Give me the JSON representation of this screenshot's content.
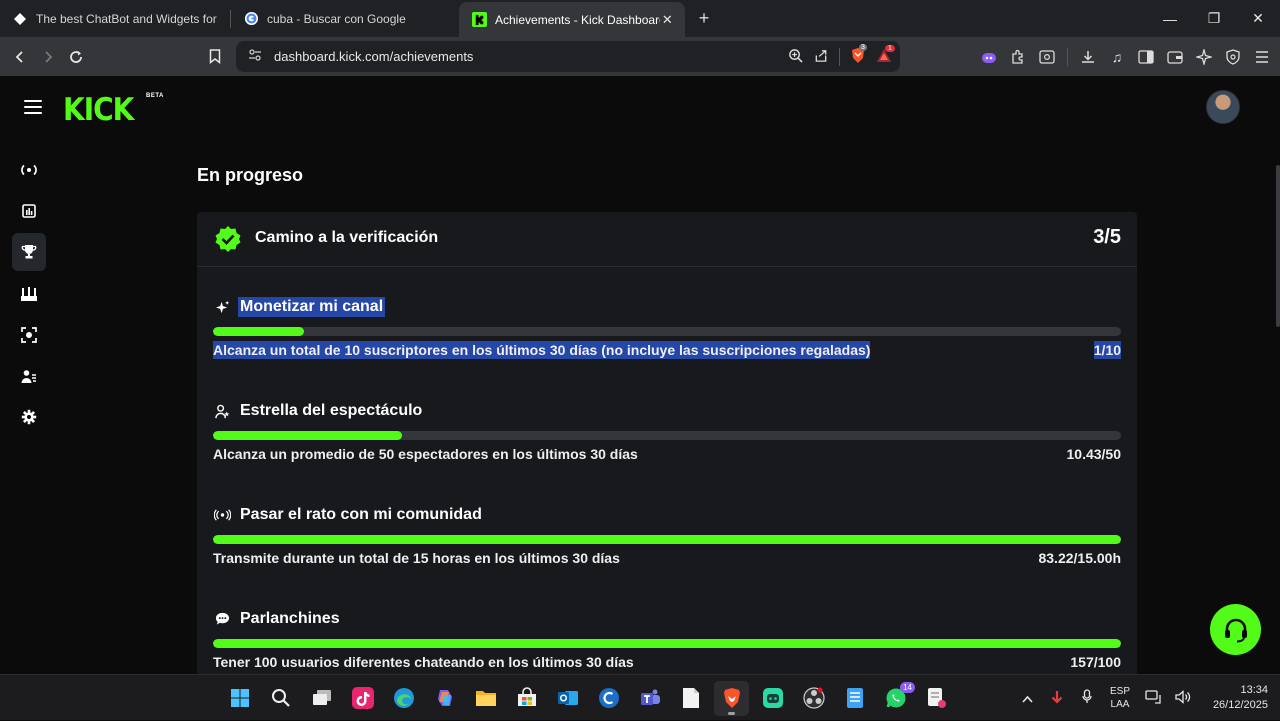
{
  "browser": {
    "tabs": [
      {
        "title": "The best ChatBot and Widgets for Kick",
        "favicon": "diamond-icon"
      },
      {
        "title": "cuba - Buscar con Google",
        "favicon": "google-icon"
      },
      {
        "title": "Achievements - Kick Dashboard",
        "favicon": "kick-icon",
        "active": true
      }
    ],
    "url": "dashboard.kick.com/achievements",
    "shield_badge": "3",
    "alert_badge": "1"
  },
  "app": {
    "logo_text": "KICK",
    "beta_label": "BETA",
    "accent_color": "#53fc18",
    "sidebar_items": [
      {
        "icon": "broadcast-icon"
      },
      {
        "icon": "analytics-icon"
      },
      {
        "icon": "trophy-icon",
        "selected": true
      },
      {
        "icon": "community-icon"
      },
      {
        "icon": "moderation-icon"
      },
      {
        "icon": "users-icon"
      },
      {
        "icon": "settings-icon"
      }
    ]
  },
  "main": {
    "section_title": "En progreso",
    "card": {
      "title": "Camino a la verificación",
      "count": "3/5",
      "achievements": [
        {
          "icon": "sparkle-icon",
          "name": "Monetizar mi canal",
          "description": "Alcanza un total de 10 suscriptores en los últimos 30 días (no incluye las suscripciones regaladas)",
          "value": "1/10",
          "progress": 0.1,
          "selected_text": true
        },
        {
          "icon": "star-user-icon",
          "name": "Estrella del espectáculo",
          "description": "Alcanza un promedio de 50 espectadores en los últimos 30 días",
          "value": "10.43/50",
          "progress": 0.2086
        },
        {
          "icon": "broadcast-icon",
          "name": "Pasar el rato con mi comunidad",
          "description": "Transmite durante un total de 15 horas en los últimos 30 días",
          "value": "83.22/15.00h",
          "progress": 1.0
        },
        {
          "icon": "chat-bubble-icon",
          "name": "Parlanchines",
          "description": "Tener 100 usuarios diferentes chateando en los últimos 30 días",
          "value": "157/100",
          "progress": 1.0
        }
      ]
    }
  },
  "taskbar": {
    "apps": [
      "windows-start-icon",
      "search-icon",
      "task-view-icon",
      "tiktok-icon",
      "edge-icon",
      "copilot-icon",
      "file-explorer-icon",
      "store-icon",
      "outlook-icon",
      "ccleaner-icon",
      "teams-icon",
      "notepad-icon",
      "brave-icon",
      "discord-icon",
      "obs-icon",
      "notes-icon",
      "whatsapp-icon",
      "snipping-icon"
    ],
    "whatsapp_badge": "14",
    "language": "ESP",
    "layout": "LAA",
    "time": "13:34",
    "date": "26/12/2025"
  }
}
